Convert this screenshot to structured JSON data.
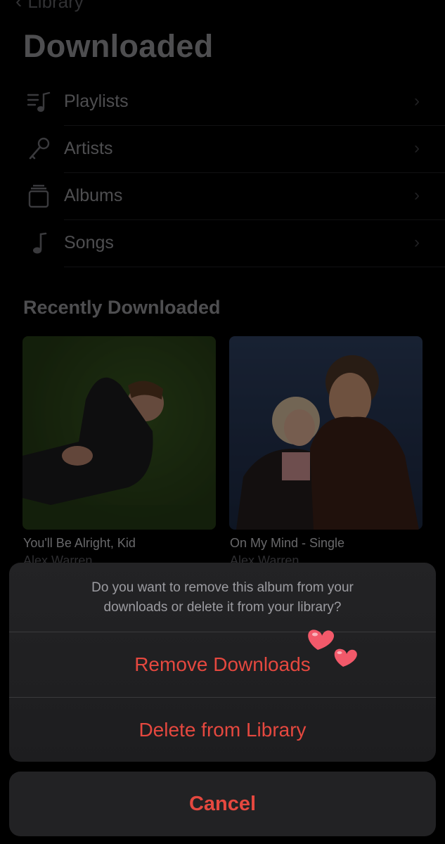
{
  "nav": {
    "back_label": "Library"
  },
  "page": {
    "title": "Downloaded"
  },
  "menu": [
    {
      "label": "Playlists",
      "icon": "playlist-icon"
    },
    {
      "label": "Artists",
      "icon": "microphone-icon"
    },
    {
      "label": "Albums",
      "icon": "album-stack-icon"
    },
    {
      "label": "Songs",
      "icon": "music-note-icon"
    }
  ],
  "recent": {
    "section_title": "Recently Downloaded",
    "albums": [
      {
        "title": "You'll Be Alright, Kid",
        "artist": "Alex Warren"
      },
      {
        "title": "On My Mind - Single",
        "artist": "Alex Warren"
      }
    ]
  },
  "action_sheet": {
    "message": "Do you want to remove this album from your downloads or delete it from your library?",
    "remove_label": "Remove Downloads",
    "delete_label": "Delete from Library",
    "cancel_label": "Cancel"
  },
  "colors": {
    "destructive": "#e5483f",
    "heart": "#f2596a"
  }
}
